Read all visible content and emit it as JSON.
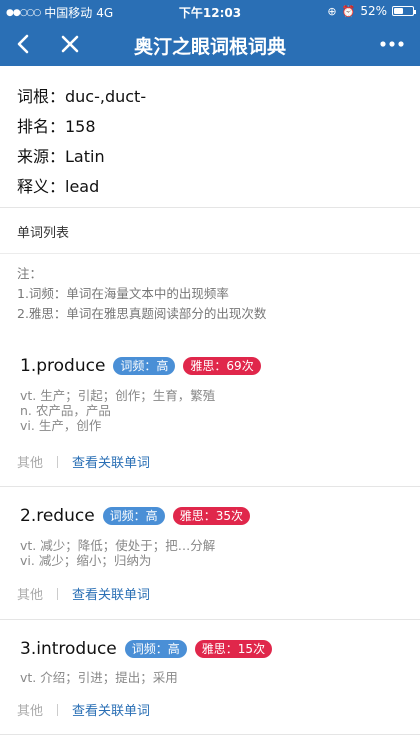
{
  "status": {
    "carrier": "中国移动",
    "network": "4G",
    "time": "下午12:03",
    "battery_text": "52%",
    "battery_level": 0.52
  },
  "nav": {
    "title": "奥汀之眼词根词典"
  },
  "info": {
    "root": "词根：duc-,duct-",
    "rank": "排名：158",
    "source": "来源：Latin",
    "meaning": "释义：lead"
  },
  "section_title": "单词列表",
  "note": {
    "head": "注：",
    "line1": "1.词频：单词在海量文本中的出现频率",
    "line2": "2.雅思：单词在雅思真题阅读部分的出现次数"
  },
  "words": [
    {
      "title": "1.produce",
      "freq": "词频：高",
      "ielts": "雅思：69次",
      "defs": [
        "vt. 生产；引起；创作；生育，繁殖",
        "n. 农产品，产品",
        "vi. 生产，创作"
      ],
      "other": "其他",
      "link": "查看关联单词"
    },
    {
      "title": "2.reduce",
      "freq": "词频：高",
      "ielts": "雅思：35次",
      "defs": [
        "vt. 减少；降低；使处于；把…分解",
        "vi. 减少；缩小；归纳为"
      ],
      "other": "其他",
      "link": "查看关联单词"
    },
    {
      "title": "3.introduce",
      "freq": "词频：高",
      "ielts": "雅思：15次",
      "defs": [
        "vt. 介绍；引进；提出；采用"
      ],
      "other": "其他",
      "link": "查看关联单词"
    }
  ],
  "colors": {
    "primary": "#2a6fb5",
    "freq_tag": "#4a8fd6",
    "ielts_tag": "#e0274b"
  }
}
